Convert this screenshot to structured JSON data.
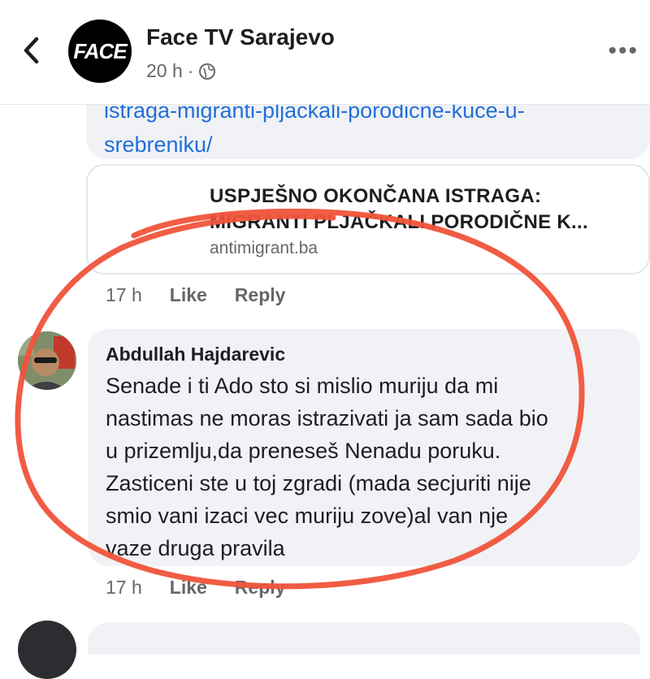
{
  "header": {
    "page_name": "Face TV Sarajevo",
    "logo_text": "FACE",
    "time": "20 h",
    "separator": "·",
    "privacy_icon": "globe-icon",
    "more_label": "•••"
  },
  "comment1": {
    "link_line1": "istraga-migranti-pljackali-porodicne-kuce-u-",
    "link_line2": "srebreniku/",
    "card": {
      "title_line1": "USPJEŠNO OKONČANA ISTRAGA:",
      "title_line2": "MIGRANTI PLJAČKALI PORODIČNE K...",
      "domain": "antimigrant.ba"
    },
    "time": "17 h",
    "like_label": "Like",
    "reply_label": "Reply"
  },
  "comment2": {
    "author": "Abdullah Hajdarevic",
    "lines": [
      "Senade i ti Ado sto si mislio muriju da mi",
      "nastimas ne moras istrazivati ja sam sada bio",
      "u prizemlju,da preneseš Nenadu poruku.",
      "Zasticeni ste u toj zgradi (mada secjuriti nije",
      "smio vani izaci vec muriju zove)al van nje",
      "vaze druga pravila"
    ],
    "time": "17 h",
    "like_label": "Like",
    "reply_label": "Reply"
  },
  "colors": {
    "link": "#216fdb",
    "bubble": "#f0f2f5",
    "secondary_text": "#65676b",
    "annotation": "#f0533a"
  }
}
